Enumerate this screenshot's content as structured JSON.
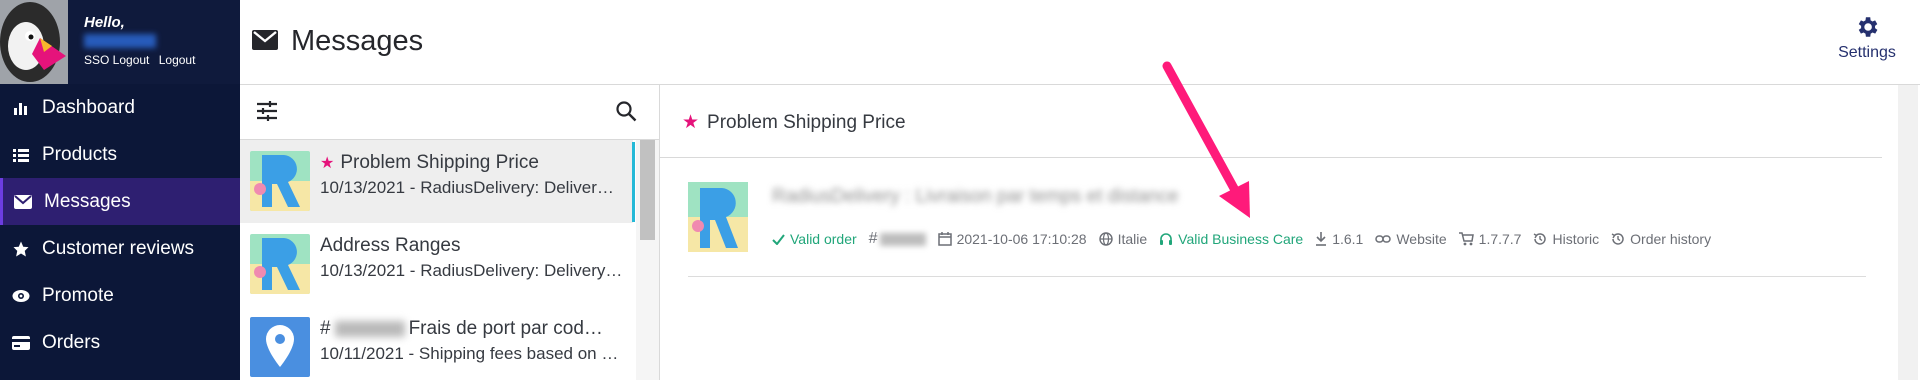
{
  "sidebar": {
    "greeting": "Hello,",
    "links": [
      "SSO Logout",
      "Logout"
    ],
    "items": [
      {
        "label": "Dashboard",
        "icon": "bar-chart-icon",
        "active": false
      },
      {
        "label": "Products",
        "icon": "list-icon",
        "active": false
      },
      {
        "label": "Messages",
        "icon": "envelope-icon",
        "active": true
      },
      {
        "label": "Customer reviews",
        "icon": "star-icon",
        "active": false
      },
      {
        "label": "Promote",
        "icon": "eye-icon",
        "active": false
      },
      {
        "label": "Orders",
        "icon": "credit-card-icon",
        "active": false
      }
    ]
  },
  "header": {
    "title": "Messages",
    "settings_label": "Settings"
  },
  "list": {
    "messages": [
      {
        "subject": "Problem Shipping Price",
        "starred": true,
        "preview": "10/13/2021 - RadiusDelivery: Deliver…",
        "thumb": "radius-logo"
      },
      {
        "subject": "Address Ranges",
        "starred": false,
        "preview": "10/13/2021 - RadiusDelivery: Delivery…",
        "thumb": "radius-logo"
      },
      {
        "subject_prefix": "#",
        "subject": "Frais de port par cod…",
        "starred": false,
        "preview": "10/11/2021 - Shipping fees based on …",
        "thumb": "map-pin"
      }
    ]
  },
  "detail": {
    "title": "Problem Shipping Price",
    "meta": {
      "order_status": "Valid order",
      "order_prefix": "#",
      "date": "2021-10-06 17:10:28",
      "country": "Italie",
      "support": "Valid Business Care",
      "module_version": "1.6.1",
      "website": "Website",
      "ps_version": "1.7.7.7",
      "historic": "Historic",
      "order_history": "Order history"
    }
  },
  "colors": {
    "sidebar_bg": "#0c1738",
    "active_item": "#2e1f71",
    "accent_star": "#e5137b",
    "valid_green": "#21a67a",
    "arrow": "#ff1a7a"
  }
}
